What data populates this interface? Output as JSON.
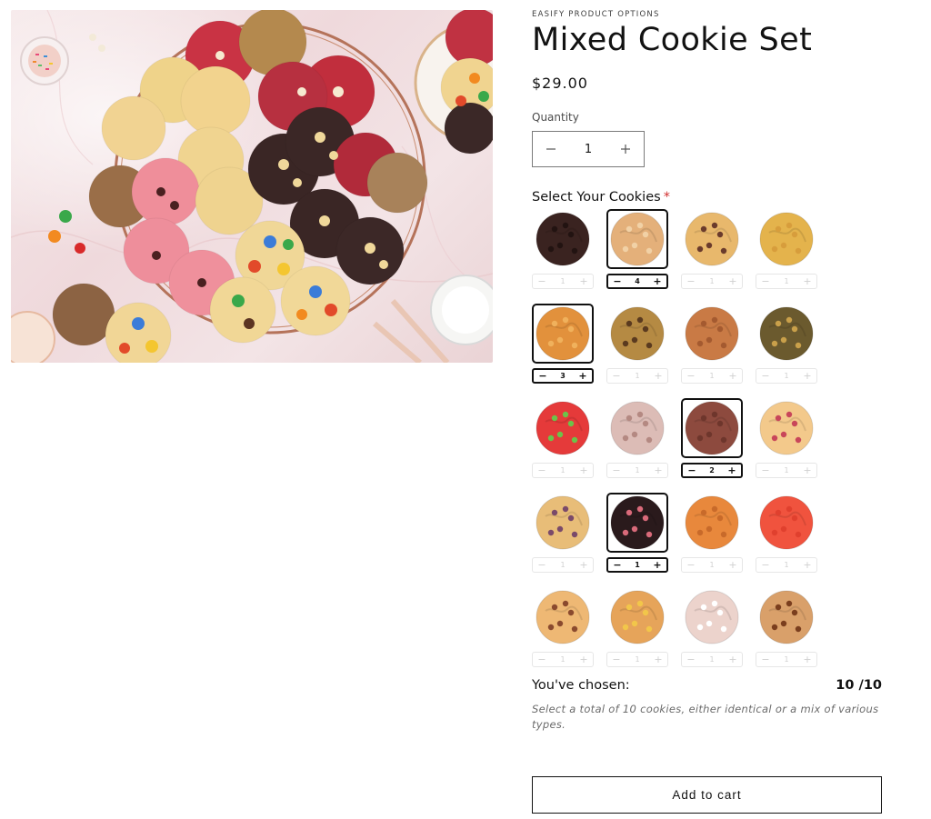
{
  "product": {
    "vendor": "EASIFY PRODUCT OPTIONS",
    "title": "Mixed Cookie Set",
    "price": "$29.00"
  },
  "quantity": {
    "label": "Quantity",
    "value": "1",
    "minus_icon": "minus-icon",
    "plus_icon": "plus-icon"
  },
  "selector": {
    "title": "Select Your Cookies",
    "required_mark": "*",
    "cookies": [
      {
        "qty": "1",
        "color": "#3a2320",
        "accent": "#221311",
        "selected": false
      },
      {
        "qty": "4",
        "color": "#e4b07a",
        "accent": "#f1d1a6",
        "selected": true
      },
      {
        "qty": "1",
        "color": "#e8b86c",
        "accent": "#6a3b2c",
        "selected": false
      },
      {
        "qty": "1",
        "color": "#e4b34c",
        "accent": "#d79d3c",
        "selected": false
      },
      {
        "qty": "3",
        "color": "#e2913c",
        "accent": "#f0b15c",
        "selected": true
      },
      {
        "qty": "1",
        "color": "#b58a43",
        "accent": "#5a3a1f",
        "selected": false
      },
      {
        "qty": "1",
        "color": "#c97a45",
        "accent": "#a45a30",
        "selected": false
      },
      {
        "qty": "1",
        "color": "#6b5a2e",
        "accent": "#c9a04a",
        "selected": false
      },
      {
        "qty": "1",
        "color": "#e53a3a",
        "accent": "#6cc24a",
        "selected": false
      },
      {
        "qty": "1",
        "color": "#dcbcb6",
        "accent": "#b48982",
        "selected": false
      },
      {
        "qty": "2",
        "color": "#8d4a3e",
        "accent": "#6e362c",
        "selected": true
      },
      {
        "qty": "1",
        "color": "#f3c98b",
        "accent": "#c8465a",
        "selected": false
      },
      {
        "qty": "1",
        "color": "#e8bd78",
        "accent": "#7a4a6a",
        "selected": false
      },
      {
        "qty": "1",
        "color": "#2a1a1c",
        "accent": "#d96a7a",
        "selected": true
      },
      {
        "qty": "1",
        "color": "#e8883c",
        "accent": "#c86a2a",
        "selected": false
      },
      {
        "qty": "1",
        "color": "#f0533e",
        "accent": "#e0402e",
        "selected": false
      },
      {
        "qty": "1",
        "color": "#eeb874",
        "accent": "#8a4a2e",
        "selected": false
      },
      {
        "qty": "1",
        "color": "#e6a45a",
        "accent": "#f2c64a",
        "selected": false
      },
      {
        "qty": "1",
        "color": "#ecd3cc",
        "accent": "#ffffff",
        "selected": false
      },
      {
        "qty": "1",
        "color": "#d9a06a",
        "accent": "#7a3e1e",
        "selected": false
      }
    ]
  },
  "summary": {
    "chosen_label": "You've chosen:",
    "chosen_count": "10 /10",
    "helper_text": "Select a total of 10 cookies, either identical or a mix of various types."
  },
  "cart": {
    "add_label": "Add to cart"
  }
}
